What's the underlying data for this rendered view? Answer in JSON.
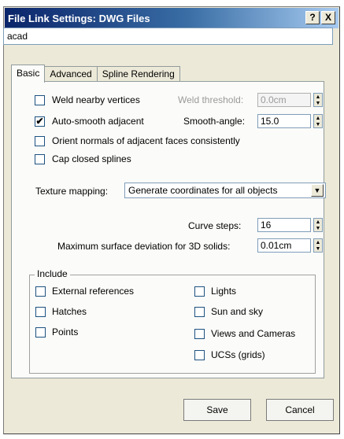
{
  "window": {
    "title": "File Link Settings: DWG Files",
    "help_label": "?",
    "close_label": "X"
  },
  "file_name": "acad",
  "tabs": [
    {
      "label": "Basic",
      "active": true
    },
    {
      "label": "Advanced",
      "active": false
    },
    {
      "label": "Spline Rendering",
      "active": false
    }
  ],
  "basic": {
    "weld_nearby_vertices": {
      "label": "Weld nearby vertices",
      "checked": false
    },
    "weld_threshold": {
      "label": "Weld threshold:",
      "value": "0.0cm",
      "enabled": false
    },
    "auto_smooth_adjacent": {
      "label": "Auto-smooth adjacent",
      "checked": true
    },
    "smooth_angle": {
      "label": "Smooth-angle:",
      "value": "15.0"
    },
    "orient_normals": {
      "label": "Orient normals of adjacent faces consistently",
      "checked": false
    },
    "cap_closed_splines": {
      "label": "Cap closed splines",
      "checked": false
    },
    "texture_mapping": {
      "label": "Texture mapping:",
      "value": "Generate coordinates for all objects"
    },
    "curve_steps": {
      "label": "Curve steps:",
      "value": "16"
    },
    "max_surface_deviation": {
      "label": "Maximum surface deviation for 3D solids:",
      "value": "0.01cm"
    }
  },
  "include": {
    "title": "Include",
    "left": [
      {
        "label": "External references",
        "checked": false
      },
      {
        "label": "Hatches",
        "checked": false
      },
      {
        "label": "Points",
        "checked": false
      }
    ],
    "right": [
      {
        "label": "Lights",
        "checked": false
      },
      {
        "label": "Sun and sky",
        "checked": false
      },
      {
        "label": "Views and Cameras",
        "checked": false
      },
      {
        "label": "UCSs (grids)",
        "checked": false
      }
    ]
  },
  "buttons": {
    "save_label": "Save",
    "cancel_label": "Cancel"
  },
  "check_glyph": "✔"
}
